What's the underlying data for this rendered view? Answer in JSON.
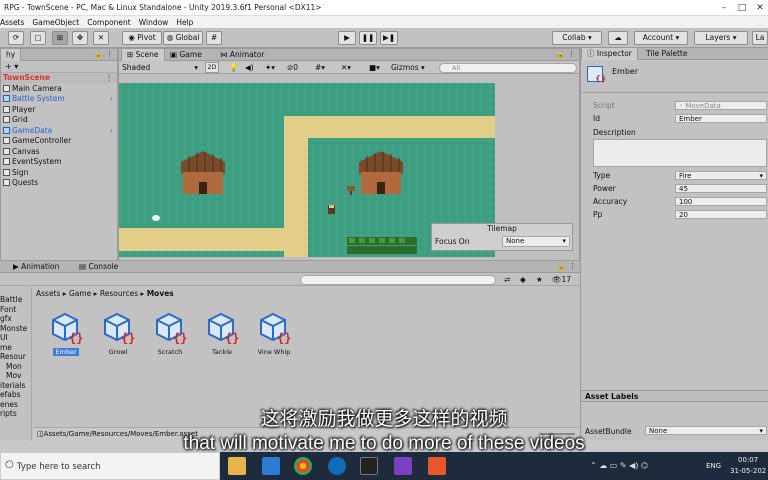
{
  "window": {
    "title": "RPG - TownScene - PC, Mac & Linux Standalone - Unity 2019.3.6f1 Personal <DX11>"
  },
  "menu": [
    "Assets",
    "GameObject",
    "Component",
    "Window",
    "Help"
  ],
  "toolbar": {
    "pivot": "Pivot",
    "global": "Global",
    "collab": "Collab",
    "account": "Account",
    "layers": "Layers"
  },
  "hierarchy": {
    "tab": "hy",
    "scene": "TownScene",
    "items": [
      {
        "label": "Main Camera",
        "blue": false
      },
      {
        "label": "Battle System",
        "blue": true
      },
      {
        "label": "Player",
        "blue": false
      },
      {
        "label": "Grid",
        "blue": false
      },
      {
        "label": "GameData",
        "blue": true
      },
      {
        "label": "GameController",
        "blue": false
      },
      {
        "label": "Canvas",
        "blue": false
      },
      {
        "label": "EventSystem",
        "blue": false
      },
      {
        "label": "Sign",
        "blue": false
      },
      {
        "label": "Quests",
        "blue": false
      }
    ]
  },
  "scene": {
    "tabs": [
      "Scene",
      "Game",
      "Animator"
    ],
    "shading": "Shaded",
    "mode2d": "2D",
    "gizmos": "Gizmos",
    "search_placeholder": "All",
    "tilemap": {
      "title": "Tilemap",
      "focus_label": "Focus On",
      "focus_value": "None"
    }
  },
  "inspector": {
    "tabs": [
      "Inspector",
      "Tile Palette"
    ],
    "object_name": "Ember",
    "fields": [
      {
        "label": "Script",
        "value": "MoveData"
      },
      {
        "label": "Id",
        "value": "Ember"
      },
      {
        "label": "Description",
        "value": ""
      },
      {
        "label": "Type",
        "value": "Fire"
      },
      {
        "label": "Power",
        "value": "45"
      },
      {
        "label": "Accuracy",
        "value": "100"
      },
      {
        "label": "Pp",
        "value": "20"
      }
    ],
    "asset_labels": "Asset Labels",
    "asset_bundle_label": "AssetBundle",
    "asset_bundle_value": "None"
  },
  "bottom_tabs": [
    "Animation",
    "Console"
  ],
  "project": {
    "breadcrumb": [
      "Assets",
      "Game",
      "Resources",
      "Moves"
    ],
    "count": "17",
    "tree": [
      "Battle",
      "Font",
      "gfx",
      "Monste",
      "UI",
      "me",
      "Resour",
      "Mon",
      "Mov",
      "iterials",
      "efabs",
      "enes",
      "ripts"
    ],
    "assets": [
      "Ember",
      "Growl",
      "Scratch",
      "Tackle",
      "Vine Whip"
    ],
    "selected": "Ember",
    "path": "Assets/Game/Resources/Moves/Ember.asset"
  },
  "subtitles": {
    "zh": "这将激励我做更多这样的视频",
    "en": "that will motivate me to do more of these videos"
  },
  "taskbar": {
    "search": "Type here to search",
    "lang": "ENG",
    "time": "00:07",
    "date": "31-05-202"
  }
}
